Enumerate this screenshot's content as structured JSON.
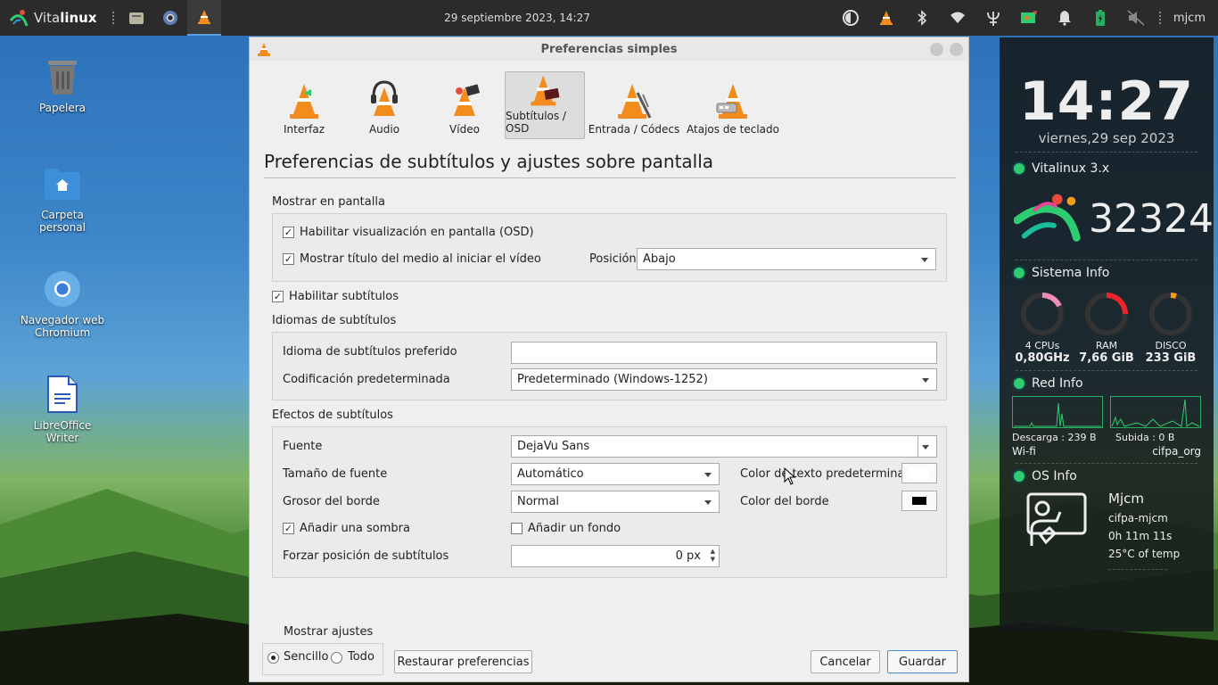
{
  "topbar": {
    "brand_prefix": "Vita",
    "brand_suffix": "linux",
    "clock": "29 septiembre 2023, 14:27",
    "user": "mjcm"
  },
  "desktop": {
    "icons": [
      {
        "label": "Papelera"
      },
      {
        "label": "Carpeta personal"
      },
      {
        "label": "Navegador web Chromium"
      },
      {
        "label": "LibreOffice Writer"
      }
    ]
  },
  "conky": {
    "time": "14:27",
    "date": "viernes,29 sep 2023",
    "distro": "Vitalinux 3.x",
    "count": "32324",
    "sys_title": "Sistema Info",
    "cpu_label": "4 CPUs",
    "cpu_value": "0,80GHz",
    "ram_label": "RAM",
    "ram_value": "7,66 GiB",
    "disk_label": "DISCO",
    "disk_value": "233 GiB",
    "net_title": "Red Info",
    "down": "Descarga : 239 B",
    "up": "Subida : 0 B",
    "net_type": "Wi-fi",
    "net_name": "cifpa_org",
    "os_title": "OS Info",
    "os_user": "Mjcm",
    "os_host": "cifpa-mjcm",
    "os_uptime": "0h 11m 11s",
    "os_temp": "25°C of temp"
  },
  "dialog": {
    "title": "Preferencias simples",
    "categories": [
      {
        "label": "Interfaz"
      },
      {
        "label": "Audio"
      },
      {
        "label": "Vídeo"
      },
      {
        "label": "Subtítulos / OSD"
      },
      {
        "label": "Entrada / Códecs"
      },
      {
        "label": "Atajos de teclado"
      }
    ],
    "page_title": "Preferencias de subtítulos y ajustes sobre pantalla",
    "osd_section": "Mostrar en pantalla",
    "enable_osd": "Habilitar visualización en pantalla (OSD)",
    "show_title": "Mostrar título del medio al iniciar el vídeo",
    "position_label": "Posición",
    "position_value": "Abajo",
    "enable_subs": "Habilitar subtítulos",
    "lang_section": "Idiomas de subtítulos",
    "pref_lang_label": "Idioma de subtítulos preferido",
    "pref_lang_value": "",
    "encoding_label": "Codificación predeterminada",
    "encoding_value": "Predeterminado (Windows-1252)",
    "effects_section": "Efectos de subtítulos",
    "font_label": "Fuente",
    "font_value": "DejaVu Sans",
    "fontsize_label": "Tamaño de fuente",
    "fontsize_value": "Automático",
    "textcolor_label": "Color de texto predeterminado",
    "border_label": "Grosor del borde",
    "border_value": "Normal",
    "bordercolor_label": "Color del borde",
    "shadow_label": "Añadir una sombra",
    "background_label": "Añadir un fondo",
    "force_pos_label": "Forzar posición de subtítulos",
    "force_pos_value": "0 px",
    "show_settings": "Mostrar ajustes",
    "simple_label": "Sencillo",
    "all_label": "Todo",
    "reset_button": "Restaurar preferencias",
    "cancel_button": "Cancelar",
    "save_button": "Guardar"
  }
}
